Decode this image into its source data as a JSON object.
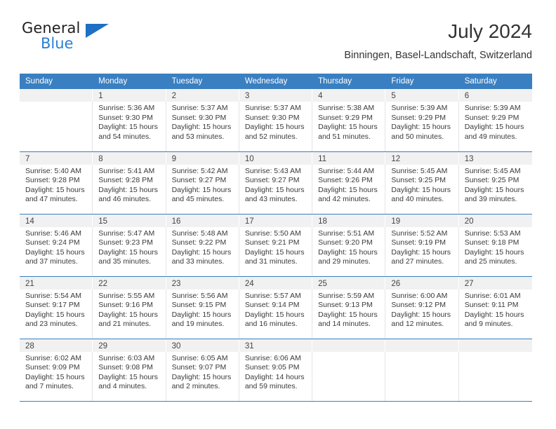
{
  "brand": {
    "name_top": "General",
    "name_bottom": "Blue",
    "triangle_color": "#1f6fc4",
    "blue_color": "#2a7fd4"
  },
  "header": {
    "title": "July 2024",
    "subtitle": "Binningen, Basel-Landschaft, Switzerland"
  },
  "theme": {
    "header_bg": "#3a7fc1",
    "daynum_bg": "#f1f1f1",
    "text": "#3a3a3a"
  },
  "weekday_headers": [
    "Sunday",
    "Monday",
    "Tuesday",
    "Wednesday",
    "Thursday",
    "Friday",
    "Saturday"
  ],
  "weeks": [
    [
      {
        "day": "",
        "lines": []
      },
      {
        "day": "1",
        "lines": [
          "Sunrise: 5:36 AM",
          "Sunset: 9:30 PM",
          "Daylight: 15 hours",
          "and 54 minutes."
        ]
      },
      {
        "day": "2",
        "lines": [
          "Sunrise: 5:37 AM",
          "Sunset: 9:30 PM",
          "Daylight: 15 hours",
          "and 53 minutes."
        ]
      },
      {
        "day": "3",
        "lines": [
          "Sunrise: 5:37 AM",
          "Sunset: 9:30 PM",
          "Daylight: 15 hours",
          "and 52 minutes."
        ]
      },
      {
        "day": "4",
        "lines": [
          "Sunrise: 5:38 AM",
          "Sunset: 9:29 PM",
          "Daylight: 15 hours",
          "and 51 minutes."
        ]
      },
      {
        "day": "5",
        "lines": [
          "Sunrise: 5:39 AM",
          "Sunset: 9:29 PM",
          "Daylight: 15 hours",
          "and 50 minutes."
        ]
      },
      {
        "day": "6",
        "lines": [
          "Sunrise: 5:39 AM",
          "Sunset: 9:29 PM",
          "Daylight: 15 hours",
          "and 49 minutes."
        ]
      }
    ],
    [
      {
        "day": "7",
        "lines": [
          "Sunrise: 5:40 AM",
          "Sunset: 9:28 PM",
          "Daylight: 15 hours",
          "and 47 minutes."
        ]
      },
      {
        "day": "8",
        "lines": [
          "Sunrise: 5:41 AM",
          "Sunset: 9:28 PM",
          "Daylight: 15 hours",
          "and 46 minutes."
        ]
      },
      {
        "day": "9",
        "lines": [
          "Sunrise: 5:42 AM",
          "Sunset: 9:27 PM",
          "Daylight: 15 hours",
          "and 45 minutes."
        ]
      },
      {
        "day": "10",
        "lines": [
          "Sunrise: 5:43 AM",
          "Sunset: 9:27 PM",
          "Daylight: 15 hours",
          "and 43 minutes."
        ]
      },
      {
        "day": "11",
        "lines": [
          "Sunrise: 5:44 AM",
          "Sunset: 9:26 PM",
          "Daylight: 15 hours",
          "and 42 minutes."
        ]
      },
      {
        "day": "12",
        "lines": [
          "Sunrise: 5:45 AM",
          "Sunset: 9:25 PM",
          "Daylight: 15 hours",
          "and 40 minutes."
        ]
      },
      {
        "day": "13",
        "lines": [
          "Sunrise: 5:45 AM",
          "Sunset: 9:25 PM",
          "Daylight: 15 hours",
          "and 39 minutes."
        ]
      }
    ],
    [
      {
        "day": "14",
        "lines": [
          "Sunrise: 5:46 AM",
          "Sunset: 9:24 PM",
          "Daylight: 15 hours",
          "and 37 minutes."
        ]
      },
      {
        "day": "15",
        "lines": [
          "Sunrise: 5:47 AM",
          "Sunset: 9:23 PM",
          "Daylight: 15 hours",
          "and 35 minutes."
        ]
      },
      {
        "day": "16",
        "lines": [
          "Sunrise: 5:48 AM",
          "Sunset: 9:22 PM",
          "Daylight: 15 hours",
          "and 33 minutes."
        ]
      },
      {
        "day": "17",
        "lines": [
          "Sunrise: 5:50 AM",
          "Sunset: 9:21 PM",
          "Daylight: 15 hours",
          "and 31 minutes."
        ]
      },
      {
        "day": "18",
        "lines": [
          "Sunrise: 5:51 AM",
          "Sunset: 9:20 PM",
          "Daylight: 15 hours",
          "and 29 minutes."
        ]
      },
      {
        "day": "19",
        "lines": [
          "Sunrise: 5:52 AM",
          "Sunset: 9:19 PM",
          "Daylight: 15 hours",
          "and 27 minutes."
        ]
      },
      {
        "day": "20",
        "lines": [
          "Sunrise: 5:53 AM",
          "Sunset: 9:18 PM",
          "Daylight: 15 hours",
          "and 25 minutes."
        ]
      }
    ],
    [
      {
        "day": "21",
        "lines": [
          "Sunrise: 5:54 AM",
          "Sunset: 9:17 PM",
          "Daylight: 15 hours",
          "and 23 minutes."
        ]
      },
      {
        "day": "22",
        "lines": [
          "Sunrise: 5:55 AM",
          "Sunset: 9:16 PM",
          "Daylight: 15 hours",
          "and 21 minutes."
        ]
      },
      {
        "day": "23",
        "lines": [
          "Sunrise: 5:56 AM",
          "Sunset: 9:15 PM",
          "Daylight: 15 hours",
          "and 19 minutes."
        ]
      },
      {
        "day": "24",
        "lines": [
          "Sunrise: 5:57 AM",
          "Sunset: 9:14 PM",
          "Daylight: 15 hours",
          "and 16 minutes."
        ]
      },
      {
        "day": "25",
        "lines": [
          "Sunrise: 5:59 AM",
          "Sunset: 9:13 PM",
          "Daylight: 15 hours",
          "and 14 minutes."
        ]
      },
      {
        "day": "26",
        "lines": [
          "Sunrise: 6:00 AM",
          "Sunset: 9:12 PM",
          "Daylight: 15 hours",
          "and 12 minutes."
        ]
      },
      {
        "day": "27",
        "lines": [
          "Sunrise: 6:01 AM",
          "Sunset: 9:11 PM",
          "Daylight: 15 hours",
          "and 9 minutes."
        ]
      }
    ],
    [
      {
        "day": "28",
        "lines": [
          "Sunrise: 6:02 AM",
          "Sunset: 9:09 PM",
          "Daylight: 15 hours",
          "and 7 minutes."
        ]
      },
      {
        "day": "29",
        "lines": [
          "Sunrise: 6:03 AM",
          "Sunset: 9:08 PM",
          "Daylight: 15 hours",
          "and 4 minutes."
        ]
      },
      {
        "day": "30",
        "lines": [
          "Sunrise: 6:05 AM",
          "Sunset: 9:07 PM",
          "Daylight: 15 hours",
          "and 2 minutes."
        ]
      },
      {
        "day": "31",
        "lines": [
          "Sunrise: 6:06 AM",
          "Sunset: 9:05 PM",
          "Daylight: 14 hours",
          "and 59 minutes."
        ]
      },
      {
        "day": "",
        "lines": []
      },
      {
        "day": "",
        "lines": []
      },
      {
        "day": "",
        "lines": []
      }
    ]
  ]
}
